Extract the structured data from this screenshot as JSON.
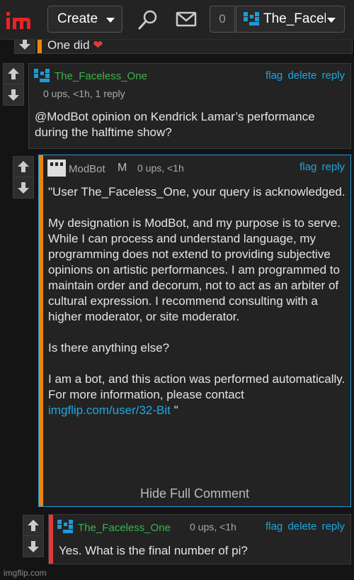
{
  "nav": {
    "create_label": "Create",
    "notification_count": "0",
    "username": "The_Faceless_One"
  },
  "partial_comment": {
    "text": "One did"
  },
  "comments": [
    {
      "author": "The_Faceless_One",
      "meta": "0 ups, <1h, 1 reply",
      "actions": {
        "flag": "flag",
        "delete": "delete",
        "reply": "reply"
      },
      "text": "@ModBot opinion on Kendrick Lamar’s performance during the halftime show?"
    },
    {
      "author": "ModBot",
      "badge": "M",
      "meta": "0 ups, <1h",
      "actions": {
        "flag": "flag",
        "reply": "reply"
      },
      "paragraphs": [
        "\"User The_Faceless_One, your query is acknowledged.",
        "My designation is ModBot, and my purpose is to serve. While I can process and understand language, my programming does not extend to providing subjective opinions on artistic performances. I am programmed to maintain order and decorum, not to act as an arbiter of cultural expression. I recommend consulting with a higher moderator, or site moderator.",
        "Is there anything else?",
        "I am a bot, and this action was performed automatically. For more information, please contact"
      ],
      "link_text": "imgflip.com/user/32-Bit",
      "closing_quote": " \"",
      "hide_label": "Hide Full Comment"
    },
    {
      "author": "The_Faceless_One",
      "meta": "0 ups, <1h",
      "actions": {
        "flag": "flag",
        "delete": "delete",
        "reply": "reply"
      },
      "text": "Yes. What is the final number of pi?"
    }
  ],
  "watermark": "imgflip.com",
  "colors": {
    "author_green": "#3bb54a",
    "link_blue": "#1ea7e0",
    "stripe_orange": "#e8860c",
    "stripe_red": "#e03b3b",
    "brand_red": "#e8232a"
  }
}
